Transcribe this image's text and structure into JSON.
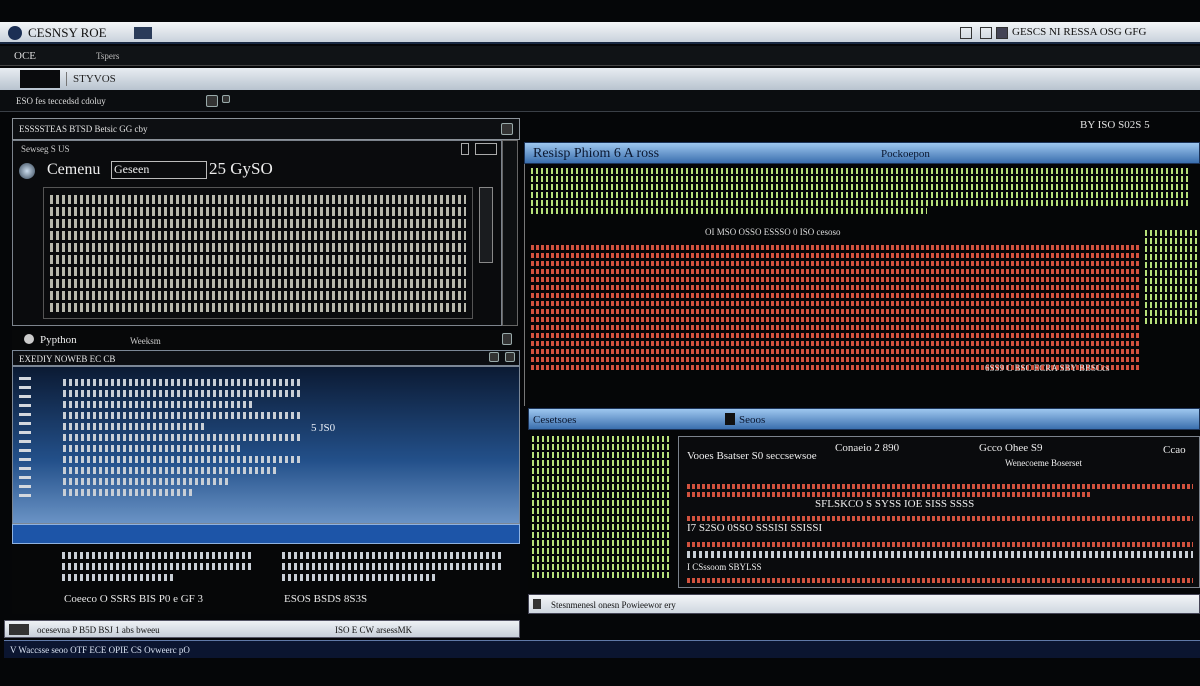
{
  "window": {
    "title": "CESNSY ROE",
    "title_right": "GESCS NI RESSA OSG GFG",
    "menu_left": "OCE",
    "menu_secondary": "Tspers"
  },
  "ribbon": {
    "tab": "STYVOS",
    "path": "ESO fes teccedsd cdoluy"
  },
  "left_panel": {
    "caption": "ESSSSTEAS BTSD Betsic GG cby",
    "sub_caption": "Sewseg S US",
    "label_name": "Cemenu",
    "field_value": "Geseen",
    "version": "25 GySO"
  },
  "python_panel": {
    "tab_label": "Pypthon",
    "tab_label_2": "Weeksm",
    "title": "EXEDIY NOWEB EC CB",
    "annotation": "5 JS0"
  },
  "bottom_left": {
    "row1_a": "Coeeco O SSRS BIS P0 e GF 3",
    "row1_b": "ESOS BSDS 8S3S",
    "status": "ocesevna P B5D BSJ 1 abs bweeu",
    "status_mid": "ISO E CW arsessMK",
    "footer": "V Waccsse seoo OTF ECE OPIE CS Ovweerc pO"
  },
  "right_top": {
    "title": "Resisp Phiom 6 A ross",
    "title_right": "Pockoepon",
    "summary": "OI MSO OSSO ESSSO 0 ISO cesoso",
    "footer": "6SS9 C BSC ECRA SBY BBSCcs"
  },
  "right_top_header": "BY ISO S02S 5",
  "right_bottom": {
    "tab_label": "Cesetsoes",
    "tab_label_2": "Seoos",
    "headings": [
      "Vooes Bsatser S0 seccsewsoe",
      "Conaeio 2 890",
      "Gcco Ohee S9",
      "Ccao"
    ],
    "header_right": "Wenecoeme Boserset",
    "row1": "SFLSKCO S SYSS IOE SISS SSSS",
    "row2": "I7 S2SO 0SSO SSSISI SSISSI",
    "row3": "I CSssoom SBYLSS",
    "footer": "Stesnmenesl onesn Powieewor ery"
  }
}
